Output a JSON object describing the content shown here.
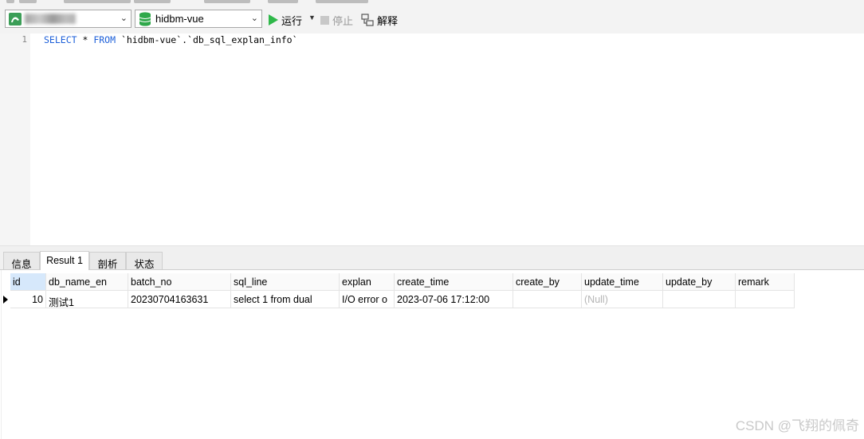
{
  "top_toolbar": {
    "visible_fragment": "..."
  },
  "connection": {
    "selected_value": "00.0.90.04"
  },
  "database": {
    "selected_value": "hidbm-vue"
  },
  "toolbar": {
    "run_label": "运行",
    "stop_label": "停止",
    "explain_label": "解释"
  },
  "editor": {
    "line_numbers": [
      "1"
    ],
    "lines": [
      {
        "kw1": "SELECT",
        "mid": " * ",
        "kw2": "FROM",
        "rest": " `hidbm-vue`.`db_sql_explan_info`"
      }
    ]
  },
  "tabs": [
    {
      "label": "信息",
      "active": false
    },
    {
      "label": "Result 1",
      "active": true
    },
    {
      "label": "剖析",
      "active": false
    },
    {
      "label": "状态",
      "active": false
    }
  ],
  "grid": {
    "columns": [
      "id",
      "db_name_en",
      "batch_no",
      "sql_line",
      "explan",
      "create_time",
      "create_by",
      "update_time",
      "update_by",
      "remark"
    ],
    "rows": [
      [
        "10",
        "测试1",
        "20230704163631",
        "select 1 from dual",
        "I/O error o",
        "2023-07-06 17:12:00",
        "",
        "(Null)",
        "",
        ""
      ]
    ]
  },
  "watermark": "CSDN @飞翔的佩奇",
  "colors": {
    "run_accent": "#2fb84a",
    "selected_header": "#d6e8fb",
    "sql_keyword": "#1c5fd9"
  }
}
